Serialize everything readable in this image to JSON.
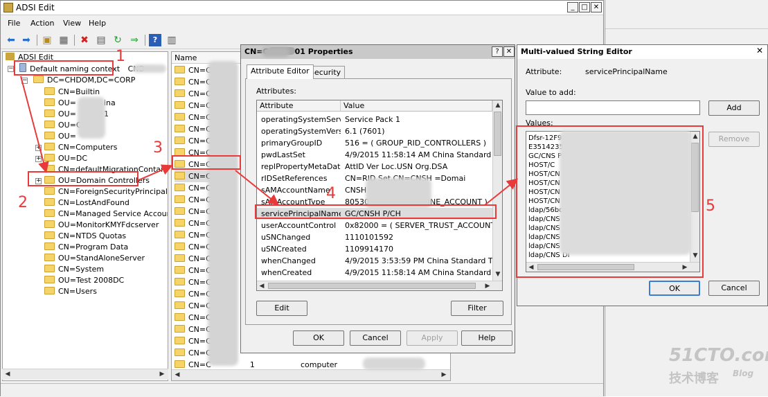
{
  "main_window": {
    "title": "ADSI Edit",
    "menu": [
      "File",
      "Action",
      "View",
      "Help"
    ]
  },
  "tree": {
    "root": "ADSI Edit",
    "naming_context": "Default naming context",
    "naming_context_suffix": "CND",
    "domain": "DC=CHDOM,DC=CORP",
    "items": [
      {
        "label": "CN=Builtin"
      },
      {
        "label": "OU=",
        "suffix": "ina"
      },
      {
        "label": "OU=",
        "suffix": "1"
      },
      {
        "label": "OU=Cl"
      },
      {
        "label": "OU="
      },
      {
        "label": "CN=Computers"
      },
      {
        "label": "OU=DC"
      },
      {
        "label": "CN=defaultMigrationContainer3"
      },
      {
        "label": "OU=Domain Controllers"
      },
      {
        "label": "CN=ForeignSecurityPrincipals"
      },
      {
        "label": "CN=LostAndFound"
      },
      {
        "label": "CN=Managed Service Accounts"
      },
      {
        "label": "OU=MonitorKMYFdcserver"
      },
      {
        "label": "CN=NTDS Quotas"
      },
      {
        "label": "CN=Program Data"
      },
      {
        "label": "OU=StandAloneServer"
      },
      {
        "label": "CN=System"
      },
      {
        "label": "OU=Test 2008DC"
      },
      {
        "label": "CN=Users"
      }
    ]
  },
  "list_pane": {
    "column_name": "Name",
    "row_prefix": "CN=CN",
    "selected_row": "CN=CN",
    "last_row": {
      "name": "CN=C",
      "suffix": "1",
      "class": "computer"
    }
  },
  "properties_dialog": {
    "title_prefix": "CN=C",
    "title_suffix": "01 Properties",
    "tabs": [
      "Attribute Editor",
      "Security"
    ],
    "attributes_label": "Attributes:",
    "columns": [
      "Attribute",
      "Value"
    ],
    "rows": [
      {
        "attr": "operatingSystemServi...",
        "value": "Service Pack 1"
      },
      {
        "attr": "operatingSystemVersi...",
        "value": "6.1 (7601)"
      },
      {
        "attr": "primaryGroupID",
        "value": "516 = ( GROUP_RID_CONTROLLERS )"
      },
      {
        "attr": "pwdLastSet",
        "value": "4/9/2015 11:58:14 AM China Standard Time"
      },
      {
        "attr": "replPropertyMetaData",
        "value": "AttID  Ver   Loc.USN            Org.DSA"
      },
      {
        "attr": "rIDSetReferences",
        "value": "CN=RID Set,CN=CNSH          =Domai"
      },
      {
        "attr": "sAMAccountName",
        "value": "CNSH"
      },
      {
        "attr": "sAMAccountType",
        "value": "805306369 = ( MACHINE_ACCOUNT )"
      },
      {
        "attr": "servicePrincipalName",
        "value": "GC/CNSH                       P/CH"
      },
      {
        "attr": "userAccountControl",
        "value": "0x82000 = ( SERVER_TRUST_ACCOUNT | T"
      },
      {
        "attr": "uSNChanged",
        "value": "1110101592"
      },
      {
        "attr": "uSNCreated",
        "value": "1109914170"
      },
      {
        "attr": "whenChanged",
        "value": "4/9/2015 3:53:59 PM China Standard Time"
      },
      {
        "attr": "whenCreated",
        "value": "4/9/2015 11:58:14 AM China Standard Time"
      }
    ],
    "edit_label": "Edit",
    "filter_label": "Filter",
    "ok_label": "OK",
    "cancel_label": "Cancel",
    "apply_label": "Apply",
    "help_label": "Help"
  },
  "mv_editor": {
    "title": "Multi-valued String Editor",
    "attribute_label": "Attribute:",
    "attribute_value": "servicePrincipalName",
    "value_to_add_label": "Value to add:",
    "value_to_add": "",
    "values_label": "Values:",
    "values": [
      "Dfsr-12F9A27C-BF97                          5EB0",
      "E3514235-4B06-11D1                     C2DCD2/5(",
      "GC/CNS                                     PM.C",
      "HOST/C",
      "HOST/CN                                   RP",
      "HOST/CN                                      N",
      "HOST/CN",
      "HOST/CN             22XDC01/CHDOM",
      "ldap/56bc    1-4c74-4921-b8d7-c9ebf49792c1.",
      "ldap/CNS",
      "ldap/CNS",
      "ldap/CNS",
      "ldap/CNS",
      "ldap/CNS                              DI"
    ],
    "add_label": "Add",
    "remove_label": "Remove",
    "ok_label": "OK",
    "cancel_label": "Cancel"
  },
  "annotations": [
    "1",
    "2",
    "3",
    "4",
    "5"
  ],
  "watermark": {
    "line1": "51CTO.com",
    "line2": "技术博客",
    "line3": "Blog"
  }
}
